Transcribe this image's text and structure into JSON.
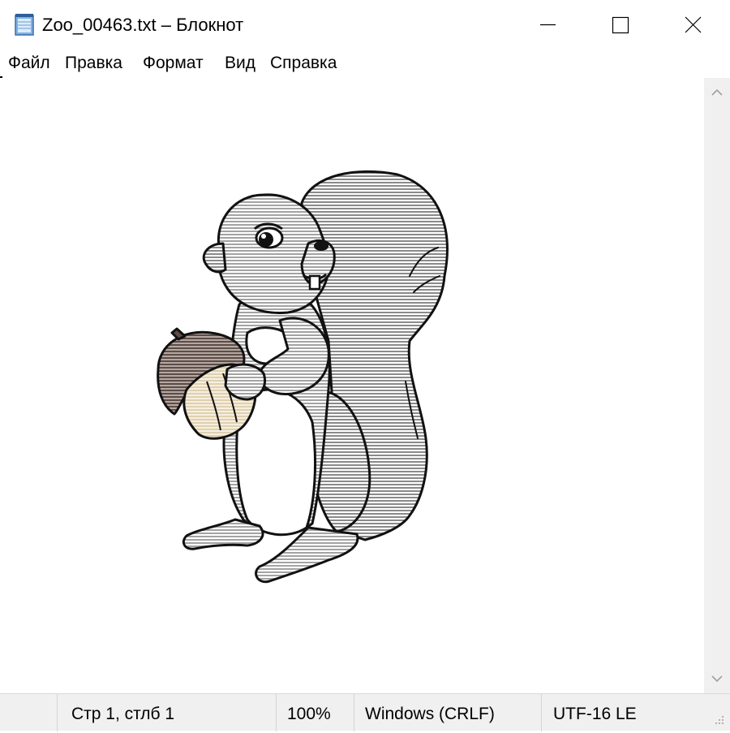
{
  "window": {
    "title": "Zoo_00463.txt – Блокнот"
  },
  "menu": {
    "items": [
      {
        "id": "file",
        "label": "Файл"
      },
      {
        "id": "edit",
        "label": "Правка"
      },
      {
        "id": "format",
        "label": "Формат"
      },
      {
        "id": "view",
        "label": "Вид"
      },
      {
        "id": "help",
        "label": "Справка"
      }
    ]
  },
  "editor": {
    "content_description": "ascii-art-squirrel-holding-acorn",
    "colors": {
      "fur": "#8f8f8f",
      "fur_light": "#a9a9a9",
      "outline": "#111111",
      "acorn_cap": "#6b5a52",
      "acorn_nut": "#e9dcc0",
      "belly": "#ffffff"
    }
  },
  "status": {
    "position": "Стр 1, стлб 1",
    "zoom": "100%",
    "line_endings": "Windows (CRLF)",
    "encoding": "UTF-16 LE"
  },
  "icons": {
    "app": "notepad-icon",
    "minimize": "minimize-icon",
    "maximize": "maximize-icon",
    "close": "close-icon",
    "scroll_up": "chevron-up-icon",
    "scroll_down": "chevron-down-icon",
    "grip": "resize-grip-icon"
  }
}
